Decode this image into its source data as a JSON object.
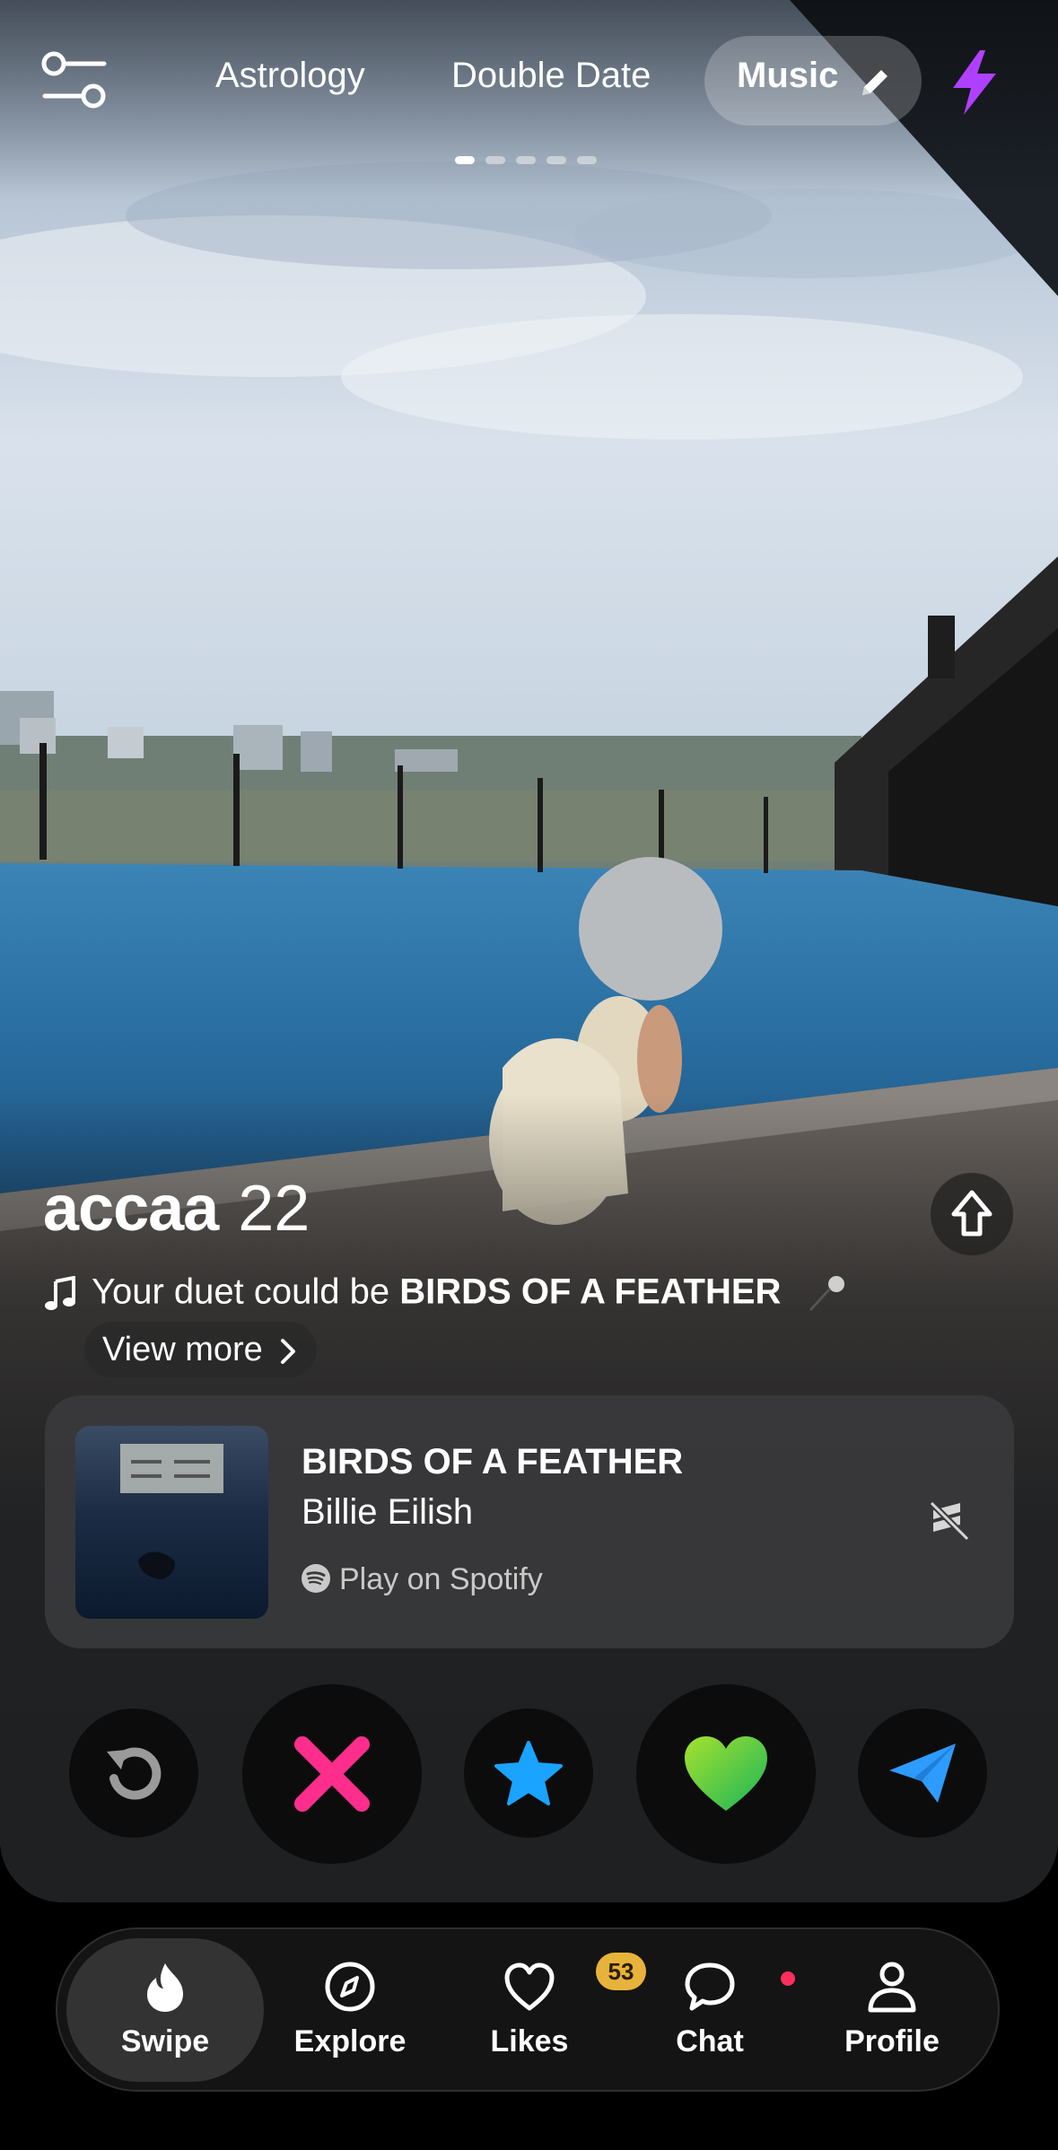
{
  "mode_tabs": [
    {
      "label": "Astrology"
    },
    {
      "label": "Double Date"
    },
    {
      "label": "Music",
      "active": true
    }
  ],
  "icons": {
    "filter": "sliders-icon",
    "edit": "pencil-icon",
    "boost": "lightning-bolt-icon",
    "expand": "arrow-up-icon",
    "note": "music-note-icon",
    "mic": "microphone-icon",
    "mute": "sound-off-icon"
  },
  "photo_pager": {
    "count": 5,
    "current": 1
  },
  "profile": {
    "name": "accaa",
    "age": "22",
    "duet_prefix": "Your duet could be ",
    "duet_song": "BIRDS OF A FEATHER",
    "view_more": "View more"
  },
  "song": {
    "title": "BIRDS OF A FEATHER",
    "artist": "Billie Eilish",
    "play_label": "Play on Spotify"
  },
  "actions": [
    {
      "name": "rewind",
      "icon": "rewind-icon",
      "color": "#9a9a9a"
    },
    {
      "name": "nope",
      "icon": "x-icon",
      "color": "#ff2e8c"
    },
    {
      "name": "super-like",
      "icon": "star-icon",
      "color": "#1aa3ff"
    },
    {
      "name": "like",
      "icon": "heart-icon",
      "color": "#4bd14b"
    },
    {
      "name": "boost",
      "icon": "paper-plane-icon",
      "color": "#2e9bff"
    }
  ],
  "nav": {
    "swipe": "Swipe",
    "explore": "Explore",
    "likes": "Likes",
    "likes_badge": "53",
    "chat": "Chat",
    "profile": "Profile"
  },
  "colors": {
    "boost": "#b040ff",
    "badge": "#e8b33a",
    "chat_dot": "#ff2e5a"
  }
}
